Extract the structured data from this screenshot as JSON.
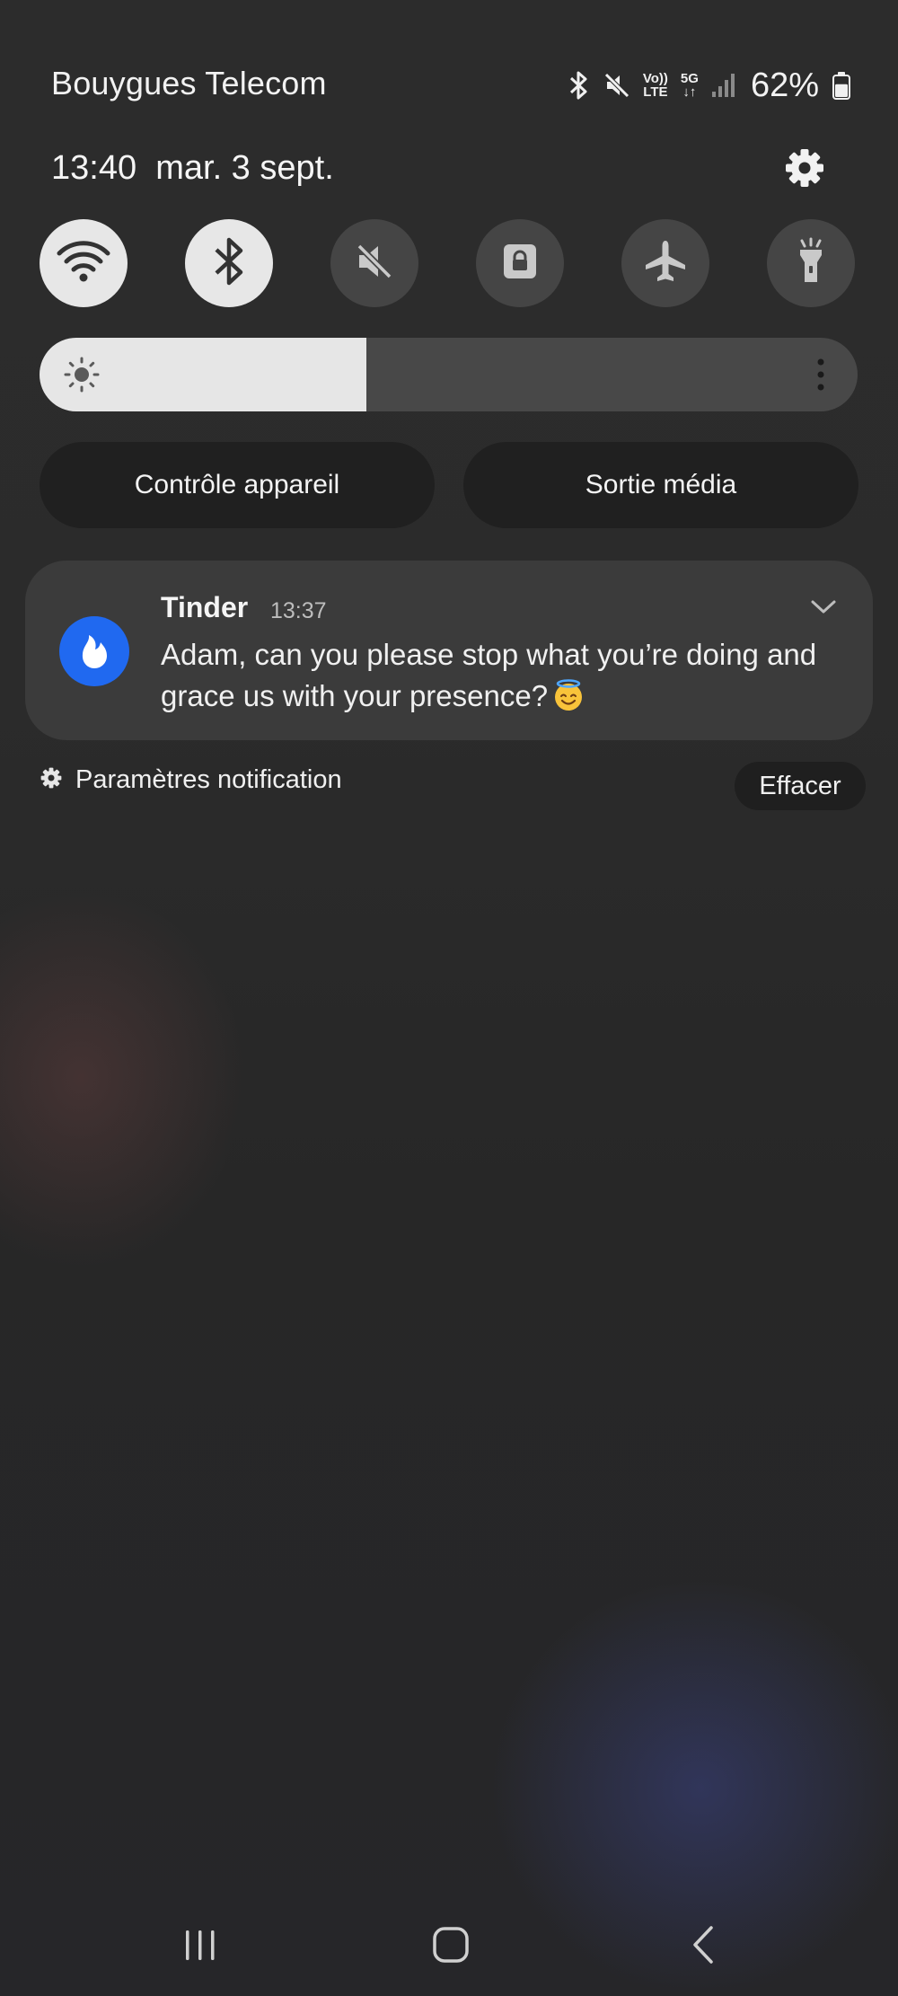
{
  "status_bar": {
    "carrier": "Bouygues Telecom",
    "volte_top": "Vo))",
    "volte_bottom": "LTE",
    "network": "5G",
    "battery_percent": "62%",
    "battery_level": 0.62,
    "icons": [
      "bluetooth-icon",
      "mute-icon",
      "volte-icon",
      "5g-data-icon",
      "signal-icon",
      "battery-icon"
    ]
  },
  "header": {
    "time": "13:40",
    "date": "mar. 3 sept."
  },
  "quick_tiles": [
    {
      "name": "wifi",
      "state": "on"
    },
    {
      "name": "bluetooth",
      "state": "on"
    },
    {
      "name": "sound-mute",
      "state": "off"
    },
    {
      "name": "screen-lock",
      "state": "off"
    },
    {
      "name": "airplane-mode",
      "state": "off"
    },
    {
      "name": "flashlight",
      "state": "off"
    }
  ],
  "brightness": {
    "level": 0.4
  },
  "buttons": {
    "device_control": "Contrôle appareil",
    "media_output": "Sortie média"
  },
  "notification": {
    "app": "Tinder",
    "time": "13:37",
    "message": "Adam, can you please stop what you’re doing and grace us with your presence?",
    "emoji": "smiling-face-with-halo",
    "app_color": "#2069f0"
  },
  "footer": {
    "settings_label": "Paramètres notification",
    "clear_label": "Effacer"
  },
  "colors": {
    "tile_on": "#e7e7e7",
    "tile_off": "#454545",
    "card": "#3b3b3b"
  }
}
